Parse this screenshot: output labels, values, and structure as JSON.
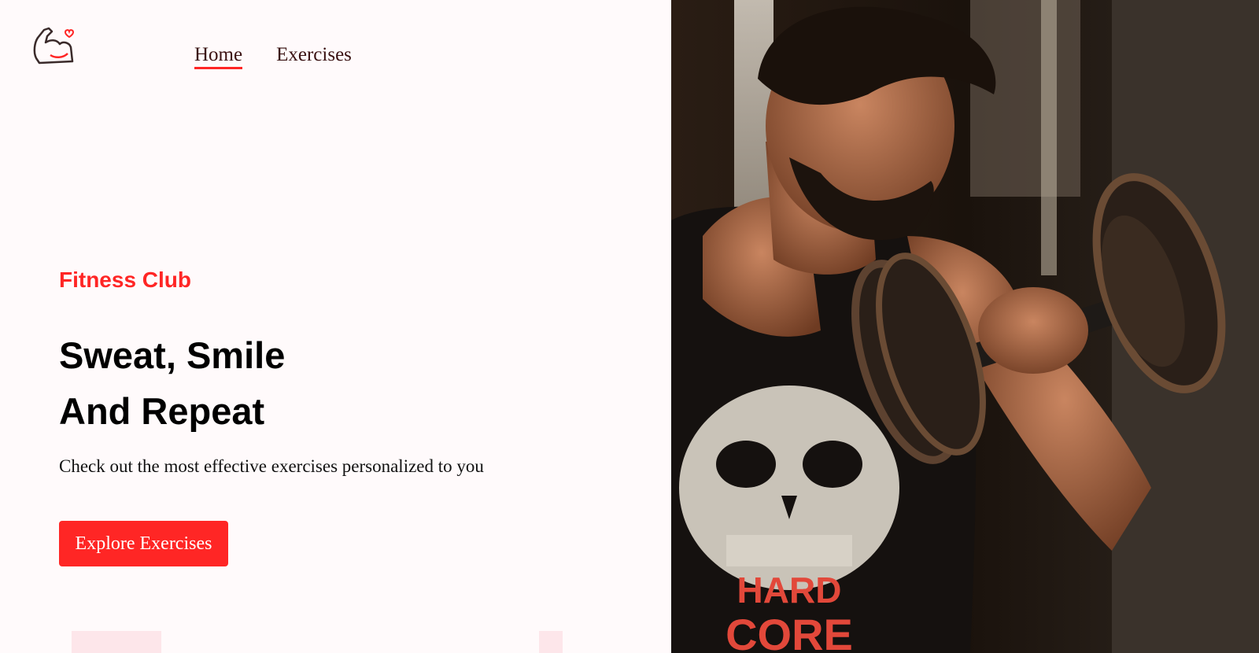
{
  "nav": {
    "items": [
      {
        "label": "Home",
        "active": true
      },
      {
        "label": "Exercises",
        "active": false
      }
    ]
  },
  "hero": {
    "kicker": "Fitness Club",
    "headline_line1": "Sweat, Smile",
    "headline_line2": "And Repeat",
    "subtitle": "Check out the most effective exercises personalized to you",
    "cta_label": "Explore Exercises"
  },
  "banner": {
    "shirt_text_line1": "HARD",
    "shirt_text_line2": "CORE"
  },
  "colors": {
    "accent": "#ff2625",
    "background": "#fffafb",
    "text": "#000000"
  },
  "icons": {
    "logo": "flexed-arm-heart-icon"
  }
}
